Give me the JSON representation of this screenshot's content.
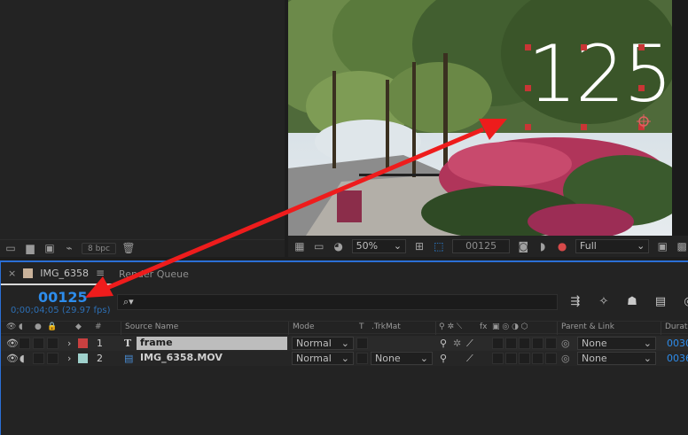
{
  "project": {
    "bpc": "8 bpc"
  },
  "viewer": {
    "overlay_text": "125",
    "zoom": "50%",
    "timecode": "00125",
    "resolution": "Full"
  },
  "timeline": {
    "tab_active": "IMG_6358",
    "tab_other": "Render Queue",
    "timecode": "00125",
    "timecode_sub": "0;00;04;05 (29.97 fps)",
    "search_placeholder": "⌕▾",
    "columns": {
      "hash": "#",
      "source_name": "Source Name",
      "mode": "Mode",
      "t": "T",
      "trkmat": ".TrkMat",
      "fx": "fx",
      "parent": "Parent & Link",
      "duration": "Duratio"
    },
    "layers": [
      {
        "num": "1",
        "type_icon": "T",
        "name": "frame",
        "mode": "Normal",
        "trkmat": "",
        "parent": "None",
        "duration": "0030",
        "color": "#c94040"
      },
      {
        "num": "2",
        "type_icon": "▤",
        "name": "IMG_6358.MOV",
        "mode": "Normal",
        "trkmat": "None",
        "parent": "None",
        "duration": "0036",
        "color": "#9fd1cc"
      }
    ]
  },
  "colors": {
    "accent": "#2d8ceb",
    "arrow": "#ee1c1c",
    "panel_border": "#2b6fd6"
  }
}
